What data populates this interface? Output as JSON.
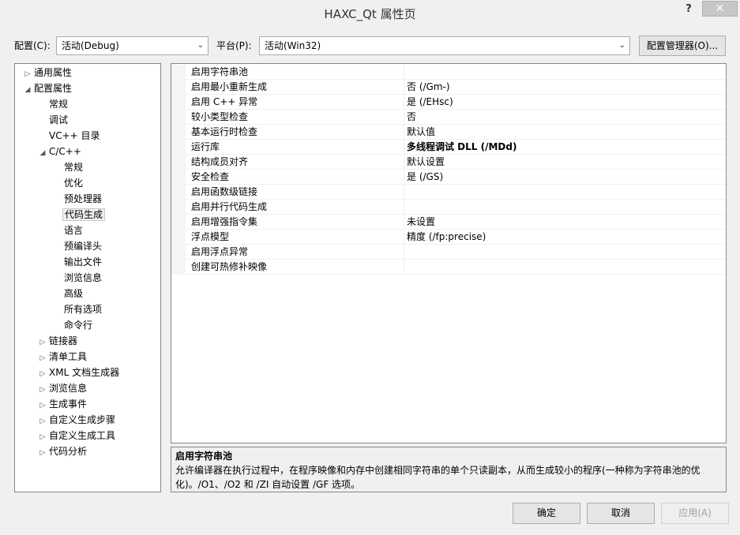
{
  "window": {
    "title": "HAXC_Qt 属性页",
    "help_label": "?",
    "close_label": "✕"
  },
  "config": {
    "label": "配置(C):",
    "value": "活动(Debug)"
  },
  "platform": {
    "label": "平台(P):",
    "value": "活动(Win32)"
  },
  "config_manager_label": "配置管理器(O)...",
  "tree": [
    {
      "label": "通用属性",
      "exp": "▷"
    },
    {
      "label": "配置属性",
      "exp": "◢"
    },
    {
      "label": "常规",
      "exp": ""
    },
    {
      "label": "调试",
      "exp": ""
    },
    {
      "label": "VC++ 目录",
      "exp": ""
    },
    {
      "label": "C/C++",
      "exp": "◢"
    },
    {
      "label": "常规",
      "exp": ""
    },
    {
      "label": "优化",
      "exp": ""
    },
    {
      "label": "预处理器",
      "exp": ""
    },
    {
      "label": "代码生成",
      "exp": ""
    },
    {
      "label": "语言",
      "exp": ""
    },
    {
      "label": "预编译头",
      "exp": ""
    },
    {
      "label": "输出文件",
      "exp": ""
    },
    {
      "label": "浏览信息",
      "exp": ""
    },
    {
      "label": "高级",
      "exp": ""
    },
    {
      "label": "所有选项",
      "exp": ""
    },
    {
      "label": "命令行",
      "exp": ""
    },
    {
      "label": "链接器",
      "exp": "▷"
    },
    {
      "label": "清单工具",
      "exp": "▷"
    },
    {
      "label": "XML 文档生成器",
      "exp": "▷"
    },
    {
      "label": "浏览信息",
      "exp": "▷"
    },
    {
      "label": "生成事件",
      "exp": "▷"
    },
    {
      "label": "自定义生成步骤",
      "exp": "▷"
    },
    {
      "label": "自定义生成工具",
      "exp": "▷"
    },
    {
      "label": "代码分析",
      "exp": "▷"
    }
  ],
  "properties": [
    {
      "name": "启用字符串池",
      "value": ""
    },
    {
      "name": "启用最小重新生成",
      "value": "否 (/Gm-)"
    },
    {
      "name": "启用 C++ 异常",
      "value": "是 (/EHsc)"
    },
    {
      "name": "较小类型检查",
      "value": "否"
    },
    {
      "name": "基本运行时检查",
      "value": "默认值"
    },
    {
      "name": "运行库",
      "value": "多线程调试 DLL (/MDd)"
    },
    {
      "name": "结构成员对齐",
      "value": "默认设置"
    },
    {
      "name": "安全检查",
      "value": "是 (/GS)"
    },
    {
      "name": "启用函数级链接",
      "value": ""
    },
    {
      "name": "启用并行代码生成",
      "value": ""
    },
    {
      "name": "启用增强指令集",
      "value": "未设置"
    },
    {
      "name": "浮点模型",
      "value": "精度 (/fp:precise)"
    },
    {
      "name": "启用浮点异常",
      "value": ""
    },
    {
      "name": "创建可热修补映像",
      "value": ""
    }
  ],
  "description": {
    "title": "启用字符串池",
    "text": "允许编译器在执行过程中，在程序映像和内存中创建相同字符串的单个只读副本，从而生成较小的程序(一种称为字符串池的优化)。/O1、/O2 和 /ZI 自动设置 /GF 选项。"
  },
  "buttons": {
    "ok": "确定",
    "cancel": "取消",
    "apply": "应用(A)"
  }
}
